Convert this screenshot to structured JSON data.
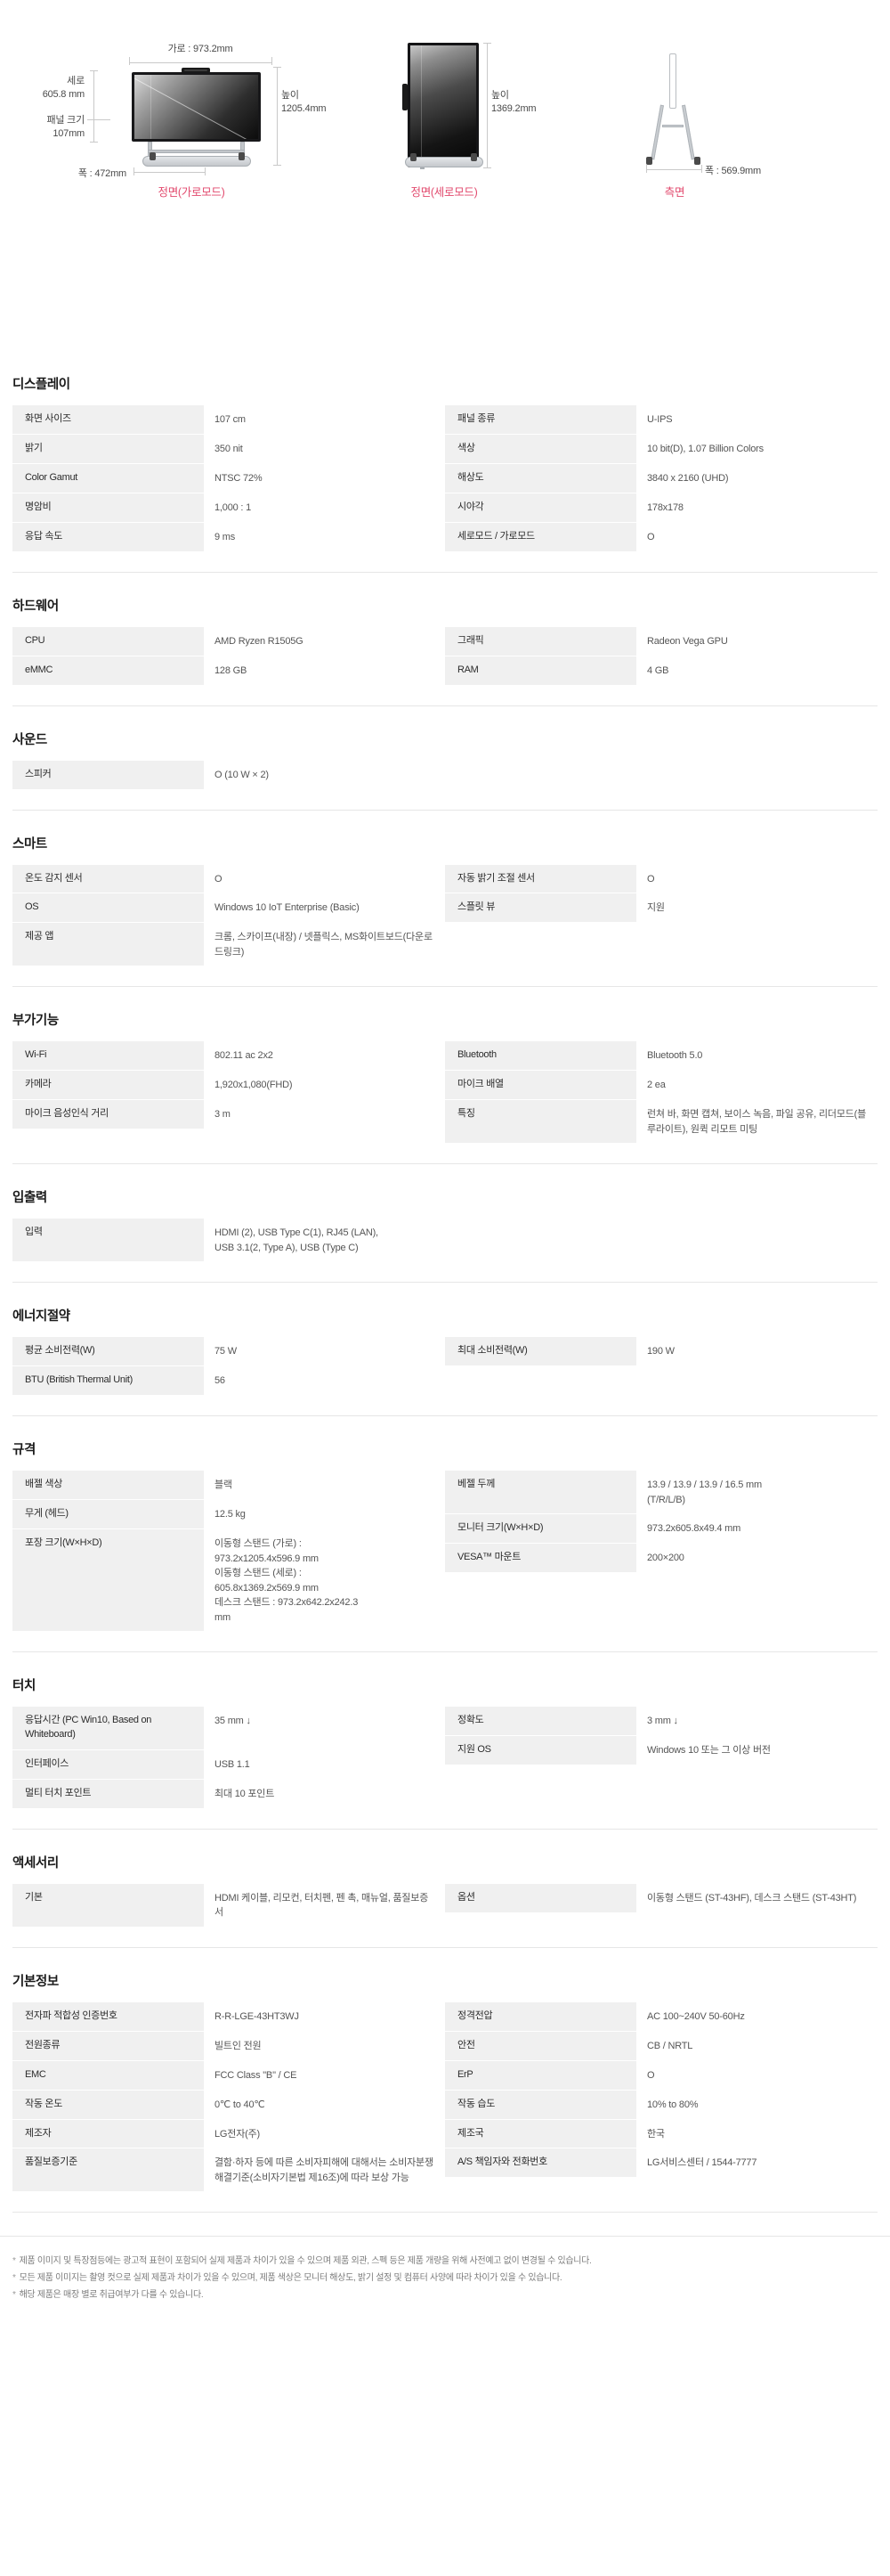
{
  "diagram": {
    "landscape": {
      "width_label": "가로 : 973.2mm",
      "height_label": "세로\n605.8 mm",
      "panel_label": "패널 크기\n107mm",
      "total_height_label": "높이\n1205.4mm",
      "depth_label": "폭 : 472mm",
      "caption": "정면(가로모드)"
    },
    "portrait": {
      "total_height_label": "높이\n1369.2mm",
      "caption": "정면(세로모드)"
    },
    "side": {
      "depth_label": "폭 : 569.9mm",
      "caption": "측면"
    }
  },
  "sections": [
    {
      "title": "디스플레이",
      "left": [
        {
          "key": "화면 사이즈",
          "value": "107 cm"
        },
        {
          "key": "밝기",
          "value": "350 nit"
        },
        {
          "key": "Color Gamut",
          "value": "NTSC 72%"
        },
        {
          "key": "명암비",
          "value": "1,000 : 1"
        },
        {
          "key": "응답 속도",
          "value": "9 ms"
        }
      ],
      "right": [
        {
          "key": "패널 종류",
          "value": "U-IPS"
        },
        {
          "key": "색상",
          "value": "10 bit(D), 1.07 Billion Colors"
        },
        {
          "key": "해상도",
          "value": "3840 x 2160 (UHD)"
        },
        {
          "key": "시야각",
          "value": "178x178"
        },
        {
          "key": "세로모드 / 가로모드",
          "value": "O"
        }
      ]
    },
    {
      "title": "하드웨어",
      "left": [
        {
          "key": "CPU",
          "value": "AMD Ryzen R1505G"
        },
        {
          "key": "eMMC",
          "value": "128 GB"
        }
      ],
      "right": [
        {
          "key": "그래픽",
          "value": "Radeon Vega GPU"
        },
        {
          "key": "RAM",
          "value": "4 GB"
        }
      ]
    },
    {
      "title": "사운드",
      "left": [
        {
          "key": "스피커",
          "value": "O (10 W × 2)"
        }
      ],
      "right": []
    },
    {
      "title": "스마트",
      "left": [
        {
          "key": "온도 감지 센서",
          "value": "O"
        },
        {
          "key": "OS",
          "value": "Windows 10 IoT Enterprise (Basic)"
        },
        {
          "key": "제공 앱",
          "value": "크롬, 스카이프(내장) / 넷플릭스, MS화이트보드(다운로드링크)"
        }
      ],
      "right": [
        {
          "key": "자동 밝기 조절 센서",
          "value": "O"
        },
        {
          "key": "스플릿 뷰",
          "value": "지원"
        }
      ]
    },
    {
      "title": "부가기능",
      "left": [
        {
          "key": "Wi-Fi",
          "value": "802.11 ac 2x2"
        },
        {
          "key": "카메라",
          "value": "1,920x1,080(FHD)"
        },
        {
          "key": "마이크 음성인식 거리",
          "value": "3 m"
        }
      ],
      "right": [
        {
          "key": "Bluetooth",
          "value": "Bluetooth 5.0"
        },
        {
          "key": "마이크 배열",
          "value": "2 ea"
        },
        {
          "key": "특징",
          "value": "런쳐 바, 화면 캡쳐, 보이스 녹음, 파일 공유, 리더모드(블루라이트), 원퀵 리모트 미팅"
        }
      ]
    },
    {
      "title": "입출력",
      "left": [
        {
          "key": "입력",
          "value": "HDMI (2), USB Type C(1), RJ45 (LAN),\nUSB 3.1(2, Type A), USB (Type C)"
        }
      ],
      "right": []
    },
    {
      "title": "에너지절약",
      "left": [
        {
          "key": "평균 소비전력(W)",
          "value": "75 W"
        },
        {
          "key": "BTU (British Thermal Unit)",
          "value": "56"
        }
      ],
      "right": [
        {
          "key": "최대 소비전력(W)",
          "value": "190 W"
        }
      ]
    },
    {
      "title": "규격",
      "left": [
        {
          "key": "배젤 색상",
          "value": "블랙"
        },
        {
          "key": "무게 (헤드)",
          "value": "12.5 kg"
        },
        {
          "key": "포장 크기(W×H×D)",
          "value": "이동형 스탠드 (가로) :\n973.2x1205.4x596.9 mm\n이동형 스탠드 (세로) :\n605.8x1369.2x569.9 mm\n데스크 스탠드 : 973.2x642.2x242.3\nmm"
        }
      ],
      "right": [
        {
          "key": "베젤 두께",
          "value": "13.9 / 13.9 / 13.9 / 16.5 mm\n(T/R/L/B)"
        },
        {
          "key": "모니터 크기(W×H×D)",
          "value": "973.2x605.8x49.4 mm"
        },
        {
          "key": "VESA™ 마운트",
          "value": "200×200"
        }
      ]
    },
    {
      "title": "터치",
      "left": [
        {
          "key": "응답시간 (PC Win10, Based on Whiteboard)",
          "value": "35 mm ↓"
        },
        {
          "key": "인터페이스",
          "value": "USB 1.1"
        },
        {
          "key": "멀티 터치 포인트",
          "value": "최대 10 포인트"
        }
      ],
      "right": [
        {
          "key": "정확도",
          "value": "3 mm ↓"
        },
        {
          "key": "지원 OS",
          "value": "Windows 10 또는 그 이상 버전"
        }
      ]
    },
    {
      "title": "액세서리",
      "left": [
        {
          "key": "기본",
          "value": "HDMI 케이블, 리모컨, 터치펜, 펜 촉, 매뉴얼, 품질보증서"
        }
      ],
      "right": [
        {
          "key": "옵션",
          "value": "이동형 스탠드 (ST-43HF), 데스크 스탠드 (ST-43HT)"
        }
      ]
    },
    {
      "title": "기본정보",
      "left": [
        {
          "key": "전자파 적합성 인증번호",
          "value": "R-R-LGE-43HT3WJ"
        },
        {
          "key": "전원종류",
          "value": "빌트인 전원"
        },
        {
          "key": "EMC",
          "value": "FCC Class \"B\" / CE"
        },
        {
          "key": "작동 온도",
          "value": "0℃ to 40℃"
        },
        {
          "key": "제조자",
          "value": "LG전자(주)"
        },
        {
          "key": "품질보증기준",
          "value": "결함·하자 등에 따른 소비자피해에 대해서는 소비자분쟁해결기준(소비자기본법 제16조)에 따라 보상 가능"
        }
      ],
      "right": [
        {
          "key": "정격전압",
          "value": "AC 100~240V 50-60Hz"
        },
        {
          "key": "안전",
          "value": "CB / NRTL"
        },
        {
          "key": "ErP",
          "value": "O"
        },
        {
          "key": "작동 습도",
          "value": "10% to 80%"
        },
        {
          "key": "제조국",
          "value": "한국"
        },
        {
          "key": "A/S 책임자와 전화번호",
          "value": "LG서비스센터 / 1544-7777"
        }
      ]
    }
  ],
  "footnotes": [
    "제품 이미지 및 특장점등에는 광고적 표현이 포함되어 실제 제품과 차이가 있을 수 있으며 제품 외관, 스펙 등은 제품 개량을 위해 사전예고 없이 변경될 수 있습니다.",
    "모든 제품 이미지는 촬영 컷으로 실제 제품과 차이가 있을 수 있으며, 제품 색상은 모니터 해상도, 밝기 설정 및 컴퓨터 사양에 따라 차이가 있을 수 있습니다.",
    "해당 제품은 매장 별로 취급여부가 다를 수 있습니다."
  ]
}
